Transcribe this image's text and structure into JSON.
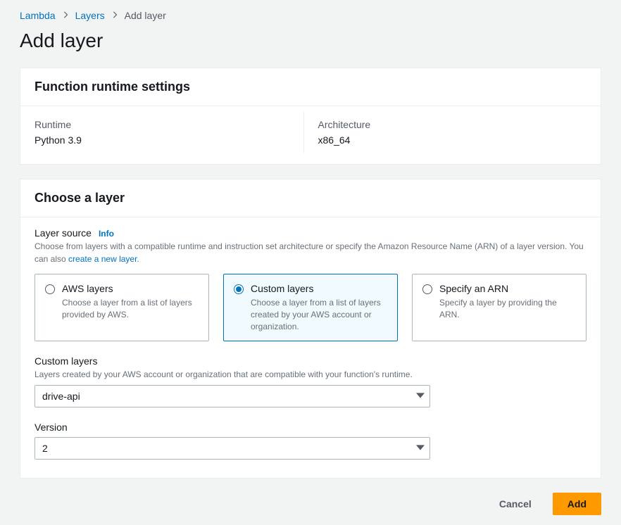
{
  "breadcrumb": {
    "root": "Lambda",
    "mid": "Layers",
    "current": "Add layer"
  },
  "page_title": "Add layer",
  "runtime_card": {
    "title": "Function runtime settings",
    "runtime_label": "Runtime",
    "runtime_value": "Python 3.9",
    "arch_label": "Architecture",
    "arch_value": "x86_64"
  },
  "choose_card": {
    "title": "Choose a layer",
    "source": {
      "label": "Layer source",
      "info": "Info",
      "desc_pre": "Choose from layers with a compatible runtime and instruction set architecture or specify the Amazon Resource Name (ARN) of a layer version. You can also ",
      "desc_link": "create a new layer",
      "desc_post": "."
    },
    "options": {
      "aws": {
        "title": "AWS layers",
        "desc": "Choose a layer from a list of layers provided by AWS."
      },
      "custom": {
        "title": "Custom layers",
        "desc": "Choose a layer from a list of layers created by your AWS account or organization."
      },
      "arn": {
        "title": "Specify an ARN",
        "desc": "Specify a layer by providing the ARN."
      }
    },
    "custom_layers": {
      "label": "Custom layers",
      "desc": "Layers created by your AWS account or organization that are compatible with your function's runtime.",
      "value": "drive-api"
    },
    "version": {
      "label": "Version",
      "value": "2"
    }
  },
  "footer": {
    "cancel": "Cancel",
    "add": "Add"
  }
}
